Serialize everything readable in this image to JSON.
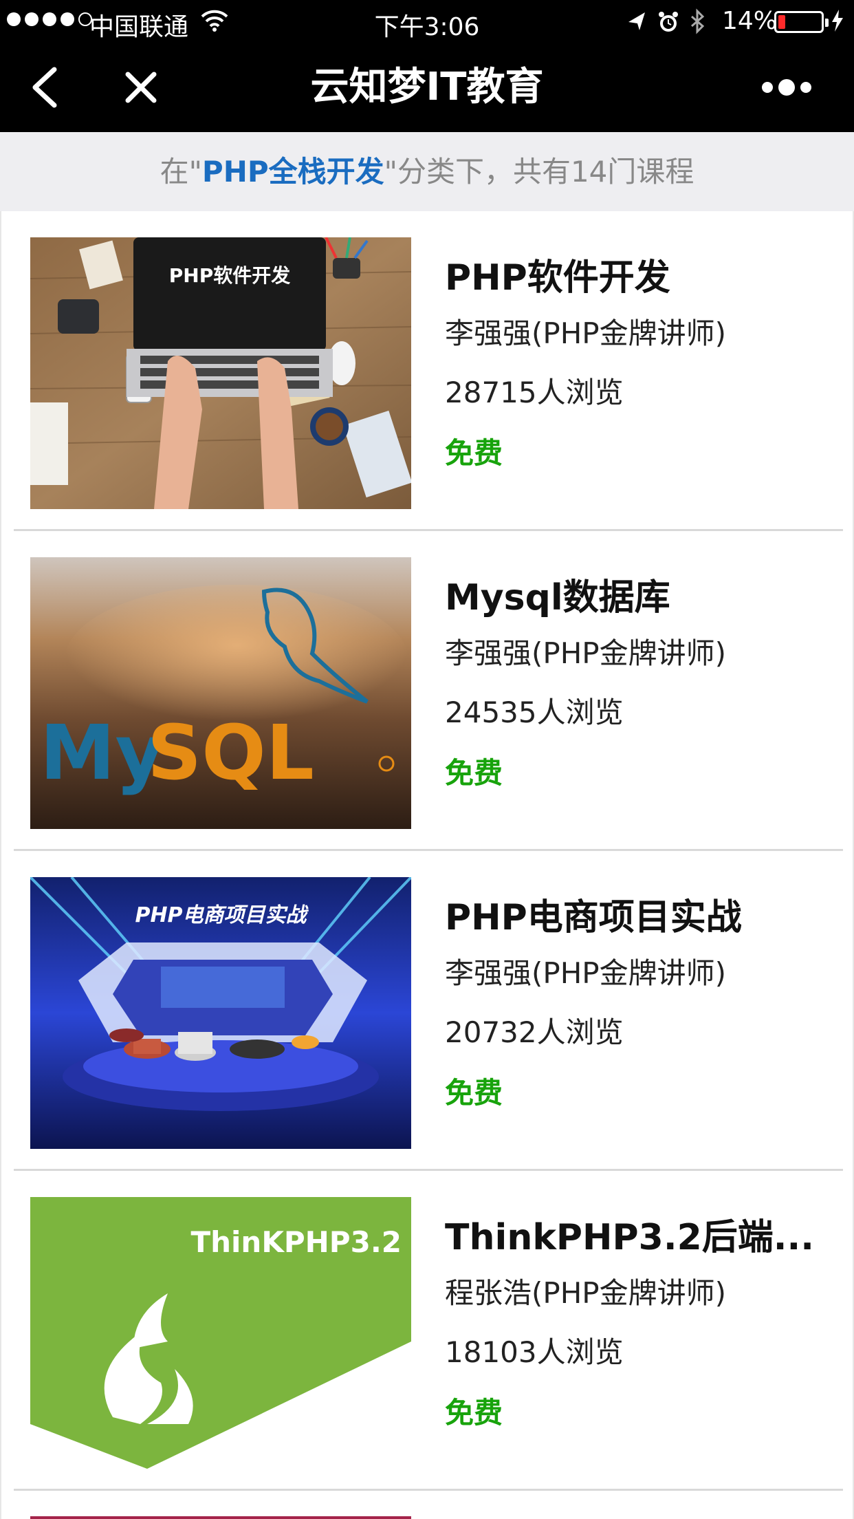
{
  "status_bar": {
    "carrier": "中国联通",
    "time": "下午3:06",
    "battery": "14%"
  },
  "nav": {
    "title": "云知梦IT教育"
  },
  "category_banner": {
    "prefix": "在\"",
    "category": "PHP全栈开发",
    "suffix": "\"分类下，共有14门课程"
  },
  "courses": [
    {
      "title": "PHP软件开发",
      "teacher": "李强强(PHP金牌讲师)",
      "views": "28715人浏览",
      "price": "免费",
      "thumb_text": "PHP软件开发"
    },
    {
      "title": "Mysql数据库",
      "teacher": "李强强(PHP金牌讲师)",
      "views": "24535人浏览",
      "price": "免费",
      "thumb_text": "MySQL"
    },
    {
      "title": "PHP电商项目实战",
      "teacher": "李强强(PHP金牌讲师)",
      "views": "20732人浏览",
      "price": "免费",
      "thumb_text": "PHP电商项目实战"
    },
    {
      "title": "ThinkPHP3.2后端...",
      "teacher": "程张浩(PHP金牌讲师)",
      "views": "18103人浏览",
      "price": "免费",
      "thumb_text": "ThinKPHP3.2"
    }
  ],
  "colors": {
    "price": "#18a30c",
    "category_highlight": "#1a6cc0",
    "battery_low": "#ff2a2a"
  },
  "icons": [
    "wifi-icon",
    "location-arrow-icon",
    "alarm-icon",
    "bluetooth-icon",
    "battery-icon",
    "charging-icon",
    "back-chevron-icon",
    "close-icon",
    "more-dots-icon"
  ]
}
